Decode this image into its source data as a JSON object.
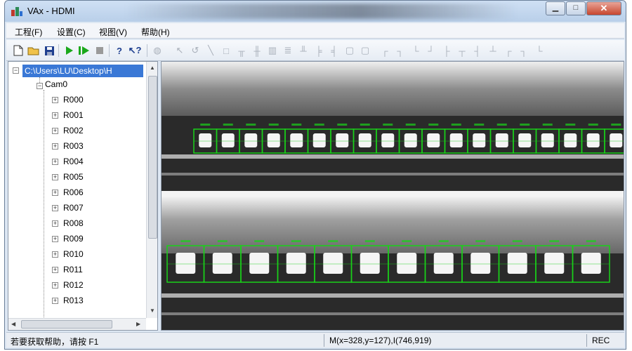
{
  "window": {
    "title": "VAx - HDMI"
  },
  "menu": [
    {
      "label": "工程(F)"
    },
    {
      "label": "设置(C)"
    },
    {
      "label": "视图(V)"
    },
    {
      "label": "帮助(H)"
    }
  ],
  "toolbar": {
    "icons": [
      "new-file-icon",
      "open-folder-icon",
      "save-icon",
      "run-icon",
      "step-run-icon",
      "stop-icon",
      "help-icon",
      "context-help-icon"
    ]
  },
  "tree": {
    "root_path": "C:\\Users\\LU\\Desktop\\H",
    "camera": "Cam0",
    "items": [
      "R000",
      "R001",
      "R002",
      "R003",
      "R004",
      "R005",
      "R006",
      "R007",
      "R008",
      "R009",
      "R010",
      "R011",
      "R012",
      "R013"
    ]
  },
  "status": {
    "help_text": "若要获取帮助，请按 F1",
    "coords": "M(x=328,y=127),I(746,919)",
    "mode": "REC"
  },
  "colors": {
    "selection": "#3a78d6",
    "roi_green": "#19d119",
    "run_green": "#1aa81a"
  }
}
